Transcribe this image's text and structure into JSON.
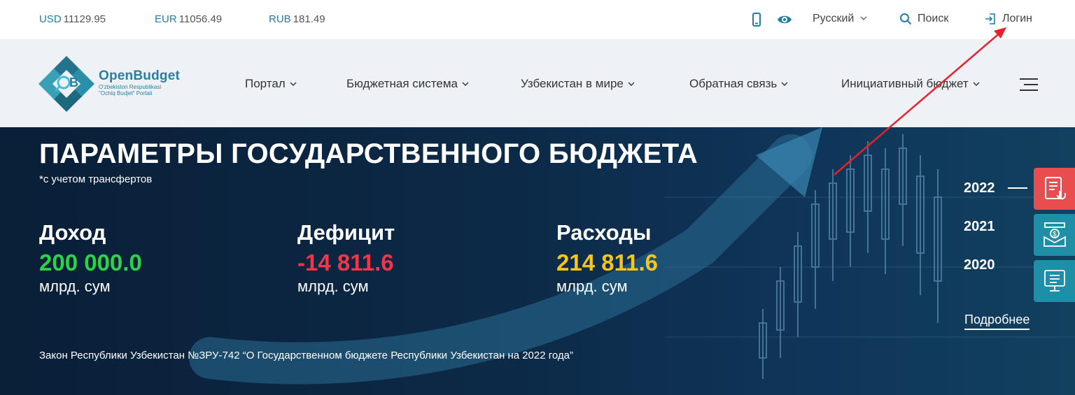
{
  "topbar": {
    "rates": [
      {
        "currency": "USD",
        "value": "11129.95"
      },
      {
        "currency": "EUR",
        "value": "11056.49"
      },
      {
        "currency": "RUB",
        "value": "181.49"
      }
    ],
    "language": "Русский",
    "search": "Поиск",
    "login": "Логин"
  },
  "logo": {
    "title": "OpenBudget",
    "sub1": "O'zbekiston Respublikasi",
    "sub2": "\"Ochiq Budjet\" Portali"
  },
  "nav": {
    "items": [
      "Портал",
      "Бюджетная система",
      "Узбекистан в мире",
      "Обратная связь",
      "Инициативный бюджет"
    ]
  },
  "hero": {
    "title": "ПАРАМЕТРЫ ГОСУДАРСТВЕННОГО БЮДЖЕТА",
    "note": "*с учетом трансфертов",
    "metrics": [
      {
        "label": "Доход",
        "value": "200 000.0",
        "unit": "млрд. сум",
        "color": "#2ed14a"
      },
      {
        "label": "Дефицит",
        "value": "-14 811.6",
        "unit": "млрд. сум",
        "color": "#f2364a"
      },
      {
        "label": "Расходы",
        "value": "214 811.6",
        "unit": "млрд. сум",
        "color": "#f5c518"
      }
    ],
    "law": "Закон Республики Узбекистан №ЗРУ-742 “О Государственном бюджете Республики Узбекистан на 2022 года”",
    "years": [
      "2022",
      "2021",
      "2020"
    ],
    "more": "Подробнее"
  },
  "colors": {
    "accent": "#1f7fa6",
    "side_red": "#e94d4d",
    "side_teal": "#1f8fa8",
    "annotation": "#e8202a"
  }
}
